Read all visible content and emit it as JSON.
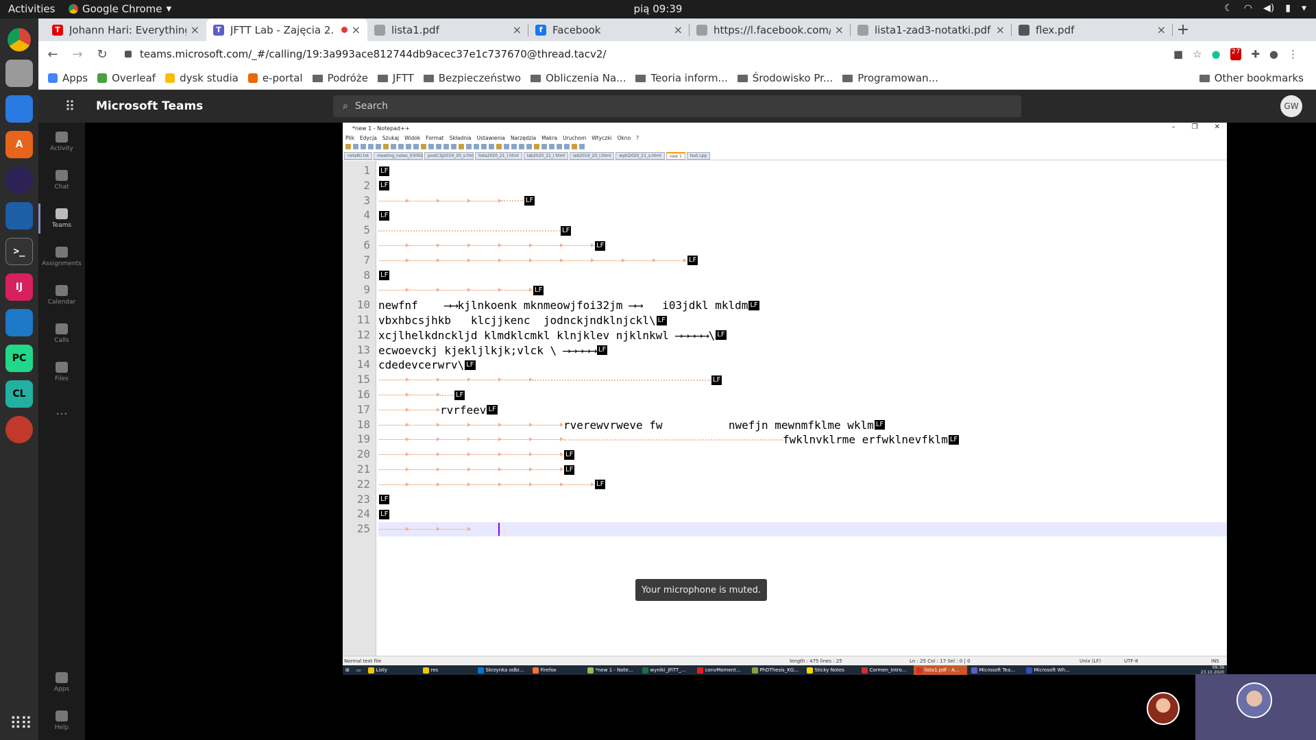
{
  "ubuntu": {
    "activities": "Activities",
    "app_name": "Google Chrome",
    "clock": "pią 09:39"
  },
  "chrome": {
    "tabs": [
      {
        "title": "Johann Hari: Everything y",
        "favicon_color": "#e00000",
        "favicon": "T"
      },
      {
        "title": "JFTT Lab - Zajęcia 2. - 2",
        "favicon_color": "#5b5fc7",
        "favicon": "T"
      },
      {
        "title": "lista1.pdf",
        "favicon_color": "#9e9e9e",
        "favicon": ""
      },
      {
        "title": "Facebook",
        "favicon_color": "#1877f2",
        "favicon": "f"
      },
      {
        "title": "https://l.facebook.com/l.",
        "favicon_color": "#9e9e9e",
        "favicon": ""
      },
      {
        "title": "lista1-zad3-notatki.pdf",
        "favicon_color": "#9e9e9e",
        "favicon": ""
      },
      {
        "title": "flex.pdf",
        "favicon_color": "#555555",
        "favicon": ""
      }
    ],
    "address": "teams.microsoft.com/_#/calling/19:3a993ace812744db9acec37e1c737670@thread.tacv2/",
    "extension_badge": "27",
    "bookmarks": [
      {
        "label": "Apps",
        "icon": "apps-icon"
      },
      {
        "label": "Overleaf",
        "icon": "overleaf-icon"
      },
      {
        "label": "dysk studia",
        "icon": "drive-icon"
      },
      {
        "label": "e-portal",
        "icon": "eportal-icon"
      },
      {
        "label": "Podróże",
        "icon": "folder-icon"
      },
      {
        "label": "JFTT",
        "icon": "folder-icon"
      },
      {
        "label": "Bezpieczeństwo",
        "icon": "folder-icon"
      },
      {
        "label": "Obliczenia Na...",
        "icon": "folder-icon"
      },
      {
        "label": "Teoria inform...",
        "icon": "folder-icon"
      },
      {
        "label": "Środowisko Pr...",
        "icon": "folder-icon"
      },
      {
        "label": "Programowan...",
        "icon": "folder-icon"
      }
    ],
    "other_bookmarks": "Other bookmarks"
  },
  "teams": {
    "title": "Microsoft Teams",
    "search_placeholder": "Search",
    "avatar_initials": "GW",
    "rail": [
      {
        "label": "Activity",
        "icon": "bell-icon"
      },
      {
        "label": "Chat",
        "icon": "chat-icon"
      },
      {
        "label": "Teams",
        "icon": "teams-icon"
      },
      {
        "label": "Assignments",
        "icon": "assignments-icon"
      },
      {
        "label": "Calendar",
        "icon": "calendar-icon"
      },
      {
        "label": "Calls",
        "icon": "phone-icon"
      },
      {
        "label": "Files",
        "icon": "file-icon"
      },
      {
        "label": "...",
        "icon": "more-icon"
      }
    ],
    "rail_bottom": [
      {
        "label": "Apps",
        "icon": "apps-icon"
      },
      {
        "label": "Help",
        "icon": "help-icon"
      }
    ],
    "toast": "Your microphone is muted."
  },
  "npp": {
    "title": "*new 1 - Notepad++",
    "menu": [
      "Plik",
      "Edycja",
      "Szukaj",
      "Widok",
      "Format",
      "Składnia",
      "Ustawienia",
      "Narzędzia",
      "Makra",
      "Uruchom",
      "Wtyczki",
      "Okno",
      "?"
    ],
    "tabs": [
      "notatki.txt",
      "meeting_notes_03092020.txt",
      "postCSJ2019_20_s.html",
      "lista2020_21_l.html",
      "lab2020_21_l.html",
      "lab2019_20_l.html",
      "wykl2020_21_s.html",
      "new 1",
      "test.cpp"
    ],
    "active_tab": "new 1",
    "lines": [
      {
        "n": "1",
        "tabs": 0,
        "text": "",
        "dots": 0
      },
      {
        "n": "2",
        "tabs": 0,
        "text": "",
        "dots": 0
      },
      {
        "n": "3",
        "tabs": 4,
        "text": "",
        "dots": 32
      },
      {
        "n": "4",
        "tabs": 0,
        "text": "",
        "dots": 0
      },
      {
        "n": "5",
        "tabs": 0,
        "text": "",
        "dots": 265
      },
      {
        "n": "6",
        "tabs": 7,
        "text": "",
        "dots": 0
      },
      {
        "n": "7",
        "tabs": 10,
        "text": "",
        "dots": 0
      },
      {
        "n": "8",
        "tabs": 0,
        "text": "",
        "dots": 0
      },
      {
        "n": "9",
        "tabs": 5,
        "text": "",
        "dots": 0
      },
      {
        "n": "10",
        "tabs": 0,
        "text": "newfnf    ⟶⟶kjlnkoenk mknmeowjfoi32jm ⟶⟶   i03jdkl mkldm",
        "dots": 0
      },
      {
        "n": "11",
        "tabs": 0,
        "text": "vbxhbcsjhkb   klcjjkenc  jodnckjndklnjckl\\",
        "dots": 0
      },
      {
        "n": "12",
        "tabs": 0,
        "text": "xcjlhelkdnckljd klmdklcmkl klnjklev njklnkwl ⟶⟶⟶⟶⟶\\",
        "dots": 0
      },
      {
        "n": "13",
        "tabs": 0,
        "text": "ecwoevckj kjekljlkjk;vlck \\ ⟶⟶⟶⟶⟶",
        "dots": 0
      },
      {
        "n": "14",
        "tabs": 0,
        "text": "cdedevcerwrv\\",
        "dots": 0
      },
      {
        "n": "15",
        "tabs": 5,
        "text": "",
        "dots": 260
      },
      {
        "n": "16",
        "tabs": 2,
        "text": "",
        "dots": 20
      },
      {
        "n": "17",
        "tabs": 2,
        "text": "rvrfeev",
        "dots": 0
      },
      {
        "n": "18",
        "tabs": 6,
        "text": "rverewvrweve fw          nwefjn mewnmfklme wklm",
        "dots": 0
      },
      {
        "n": "19",
        "tabs": 6,
        "text": "fwklnvklrme erfwklnevfklm",
        "dots": 320
      },
      {
        "n": "20",
        "tabs": 6,
        "text": "",
        "dots": 0
      },
      {
        "n": "21",
        "tabs": 6,
        "text": "",
        "dots": 0
      },
      {
        "n": "22",
        "tabs": 7,
        "text": "",
        "dots": 0
      },
      {
        "n": "23",
        "tabs": 0,
        "text": "",
        "dots": 0
      },
      {
        "n": "24",
        "tabs": 0,
        "text": "",
        "dots": 0
      },
      {
        "n": "25",
        "tabs": 3,
        "text": "",
        "dots": 0
      }
    ],
    "eol_label": "LF",
    "status": {
      "type": "Normal text file",
      "length": "length : 475    lines : 25",
      "pos": "Ln : 25    Col : 17    Sel : 0 | 0",
      "eol": "Unix (LF)",
      "encoding": "UTF-8",
      "mode": "INS"
    }
  },
  "windows_taskbar": {
    "items": [
      {
        "label": "Listy",
        "color": "#f2c511"
      },
      {
        "label": "res",
        "color": "#f2c511"
      },
      {
        "label": "Skrzynka odbi...",
        "color": "#0078d4"
      },
      {
        "label": "Firefox",
        "color": "#ff7139"
      },
      {
        "label": "*new 1 - Note...",
        "color": "#90c050"
      },
      {
        "label": "wyniki_JFiTT_...",
        "color": "#1d6f42"
      },
      {
        "label": "convMoment...",
        "color": "#e02020"
      },
      {
        "label": "PhDThesis_KG...",
        "color": "#8aa040"
      },
      {
        "label": "Sticky Notes",
        "color": "#f8d800"
      },
      {
        "label": "Cormen_Intro...",
        "color": "#d03030"
      },
      {
        "label": "lista1.pdf - A...",
        "color": "#d03030"
      },
      {
        "label": "Microsoft Tea...",
        "color": "#5b5fc7"
      },
      {
        "label": "Microsoft Wh...",
        "color": "#3050c0"
      }
    ],
    "active_index": 10,
    "time": "09:39",
    "date": "23.10.2020"
  }
}
